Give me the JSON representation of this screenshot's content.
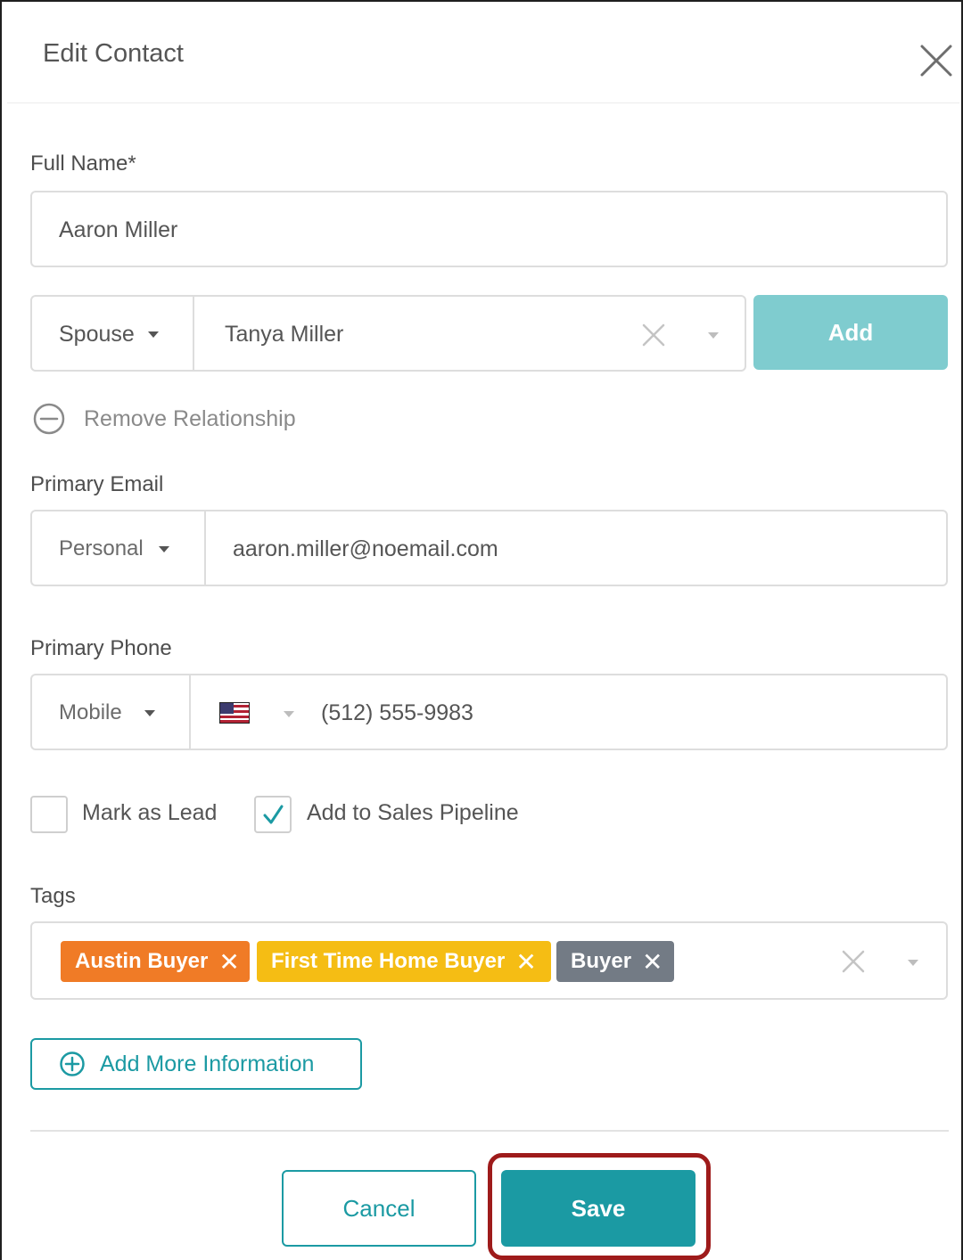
{
  "modal": {
    "title": "Edit Contact"
  },
  "full_name": {
    "label": "Full Name*",
    "value": "Aaron Miller"
  },
  "relationship": {
    "type": "Spouse",
    "value": "Tanya Miller",
    "add_label": "Add",
    "remove_label": "Remove Relationship"
  },
  "email": {
    "label": "Primary Email",
    "type": "Personal",
    "value": "aaron.miller@noemail.com"
  },
  "phone": {
    "label": "Primary Phone",
    "type": "Mobile",
    "country_icon": "us-flag-icon",
    "value": "(512) 555-9983"
  },
  "checkboxes": {
    "mark_as_lead": {
      "label": "Mark as Lead",
      "checked": false
    },
    "add_to_pipeline": {
      "label": "Add to Sales Pipeline",
      "checked": true
    }
  },
  "tags": {
    "label": "Tags",
    "items": [
      {
        "label": "Austin Buyer",
        "color": "#f07b26"
      },
      {
        "label": "First Time Home Buyer",
        "color": "#f5bd14"
      },
      {
        "label": "Buyer",
        "color": "#737b85"
      }
    ]
  },
  "add_more_label": "Add More Information",
  "footer": {
    "cancel_label": "Cancel",
    "save_label": "Save"
  },
  "colors": {
    "accent": "#1b9aa3",
    "add_button": "#7fcccf",
    "highlight": "#9e1b1b"
  }
}
